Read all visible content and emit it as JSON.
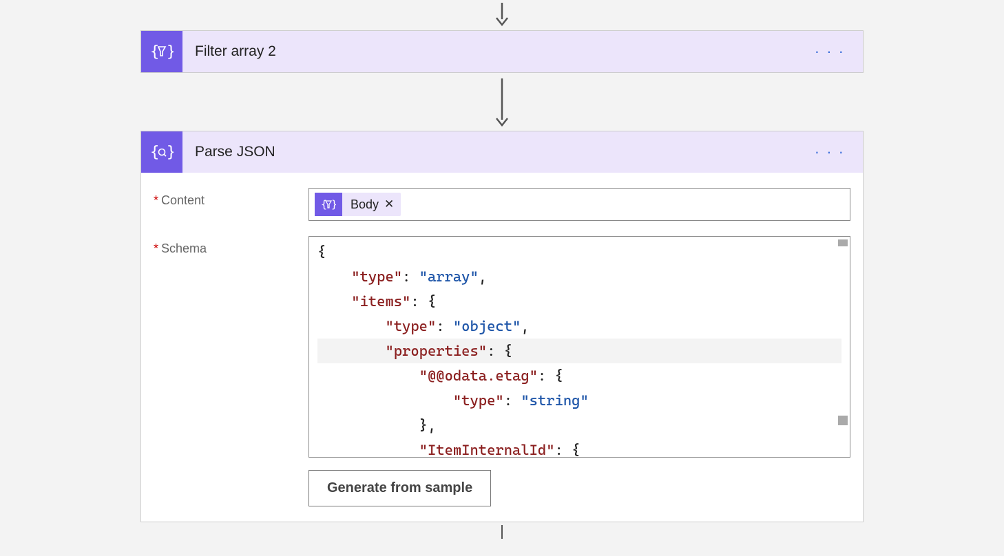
{
  "card1": {
    "title": "Filter array 2"
  },
  "card2": {
    "title": "Parse JSON",
    "fields": {
      "content_label": "Content",
      "schema_label": "Schema",
      "token_label": "Body",
      "generate_button": "Generate from sample"
    },
    "schema_json": {
      "line1": "{",
      "line2_key": "\"type\"",
      "line2_val": "\"array\"",
      "line3_key": "\"items\"",
      "line4_key": "\"type\"",
      "line4_val": "\"object\"",
      "line5_key": "\"properties\"",
      "line6_key": "\"@@odata.etag\"",
      "line7_key": "\"type\"",
      "line7_val": "\"string\"",
      "line8": "},",
      "line9_key": "\"ItemInternalId\""
    }
  }
}
